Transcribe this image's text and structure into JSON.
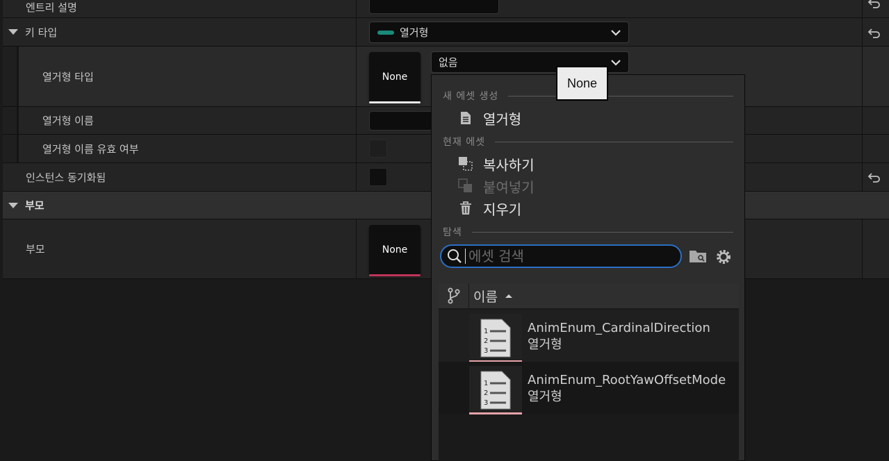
{
  "rows": {
    "entry_desc": {
      "label": "엔트리 설명"
    },
    "key_type": {
      "label": "키 타입",
      "value": "열거형",
      "pin_color": "#1a8a7a"
    },
    "enum_type": {
      "label": "열거형 타입",
      "thumb": "None",
      "combo_value": "없음",
      "thumb_bar_color": "#e8e8e8"
    },
    "enum_name": {
      "label": "열거형 이름"
    },
    "enum_name_valid": {
      "label": "열거형 이름 유효 여부"
    },
    "instance_synced": {
      "label": "인스턴스 동기화됨"
    },
    "parent_section": {
      "label": "부모"
    },
    "parent": {
      "label": "부모",
      "thumb": "None",
      "thumb_bar_color": "#c0355a"
    }
  },
  "popup": {
    "create_header": "새 에셋 생성",
    "create_item": "열거형",
    "current_header": "현재 에셋",
    "copy": "복사하기",
    "paste": "붙여넣기",
    "clear": "지우기",
    "browse_header": "탐색",
    "search_placeholder": "에셋 검색",
    "column_name": "이름",
    "assets": [
      {
        "name": "AnimEnum_CardinalDirection",
        "type": "열거형"
      },
      {
        "name": "AnimEnum_RootYawOffsetMode",
        "type": "열거형"
      }
    ]
  },
  "tooltip": "None",
  "colors": {
    "accent": "#2b6fc6",
    "panel": "#2d2d2d",
    "background": "#1a1a1a"
  }
}
